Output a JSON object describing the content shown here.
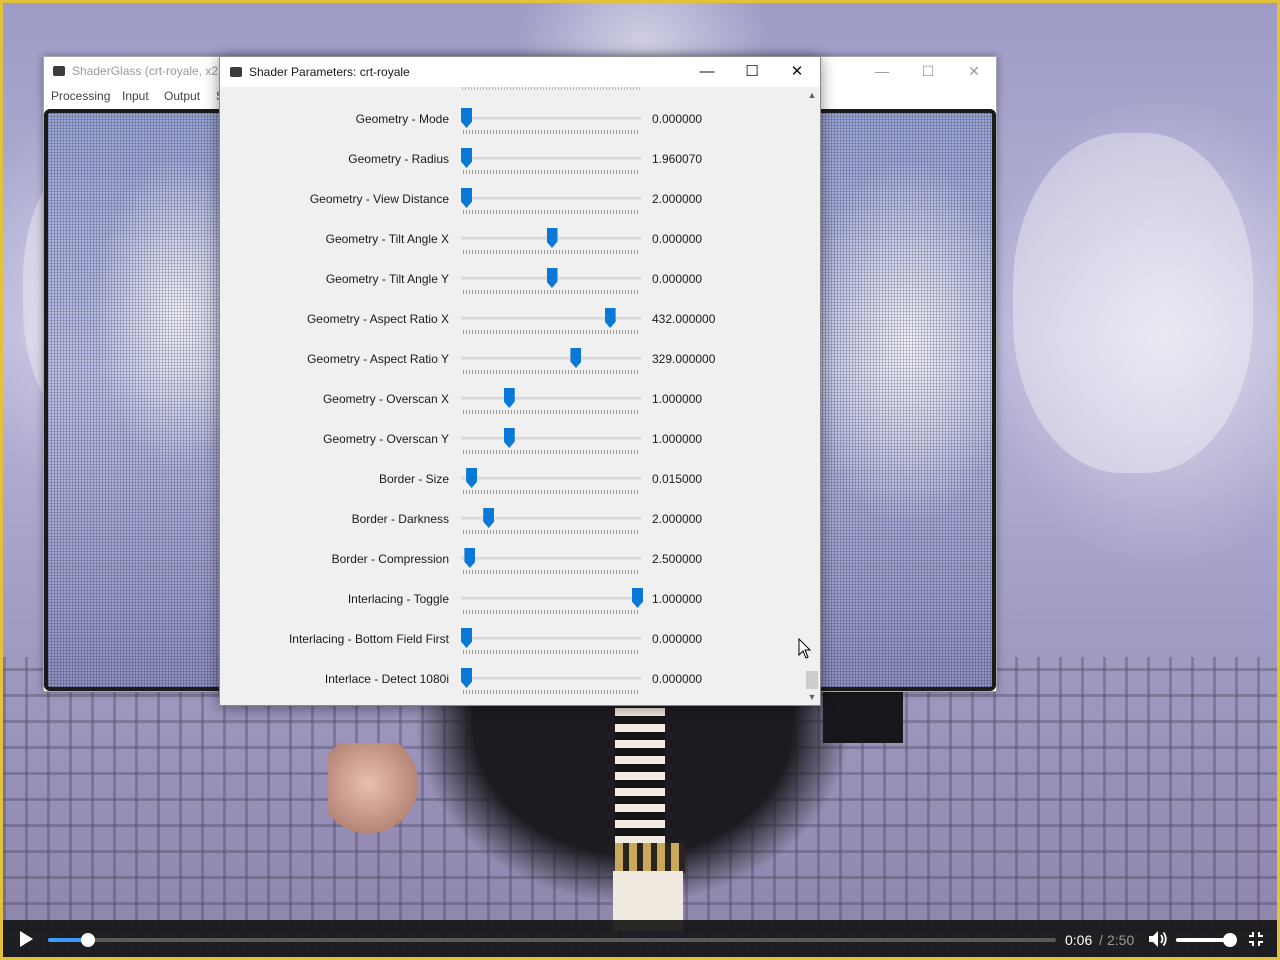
{
  "shaderglass": {
    "title": "ShaderGlass (crt-royale, x2,",
    "menu": [
      "Processing",
      "Input",
      "Output",
      "S"
    ],
    "controls": {
      "minimize": "—",
      "maximize": "☐",
      "close": "✕"
    }
  },
  "dialog": {
    "title": "Shader Parameters: crt-royale",
    "controls": {
      "minimize": "—",
      "maximize": "☐",
      "close": "✕"
    },
    "scroll_up": "▲",
    "scroll_down": "▼",
    "parameters": [
      {
        "label": "Geometry - Mode",
        "value": "0.000000",
        "position": 0.0
      },
      {
        "label": "Geometry - Radius",
        "value": "1.960070",
        "position": 0.0
      },
      {
        "label": "Geometry - View Distance",
        "value": "2.000000",
        "position": 0.0
      },
      {
        "label": "Geometry - Tilt Angle X",
        "value": "0.000000",
        "position": 0.5
      },
      {
        "label": "Geometry - Tilt Angle Y",
        "value": "0.000000",
        "position": 0.5
      },
      {
        "label": "Geometry - Aspect Ratio X",
        "value": "432.000000",
        "position": 0.84
      },
      {
        "label": "Geometry - Aspect Ratio Y",
        "value": "329.000000",
        "position": 0.64
      },
      {
        "label": "Geometry - Overscan X",
        "value": "1.000000",
        "position": 0.25
      },
      {
        "label": "Geometry - Overscan Y",
        "value": "1.000000",
        "position": 0.25
      },
      {
        "label": "Border - Size",
        "value": "0.015000",
        "position": 0.03
      },
      {
        "label": "Border - Darkness",
        "value": "2.000000",
        "position": 0.13
      },
      {
        "label": "Border - Compression",
        "value": "2.500000",
        "position": 0.02
      },
      {
        "label": "Interlacing - Toggle",
        "value": "1.000000",
        "position": 1.0
      },
      {
        "label": "Interlacing - Bottom Field First",
        "value": "0.000000",
        "position": 0.0
      },
      {
        "label": "Interlace - Detect 1080i",
        "value": "0.000000",
        "position": 0.0
      }
    ]
  },
  "player": {
    "current_time": "0:06",
    "separator": "/",
    "total_time": "2:50",
    "progress": 0.04,
    "volume": 1.0
  },
  "colors": {
    "accent": "#0a78d7",
    "seek_fill": "#3d9bff",
    "frame_border": "#e2c23a"
  },
  "icons": {
    "play": "play-icon",
    "volume": "speaker-icon",
    "fullscreen": "fullscreen-icon",
    "cursor": "mouse-pointer-icon",
    "app": "shaderglass-app-icon"
  }
}
